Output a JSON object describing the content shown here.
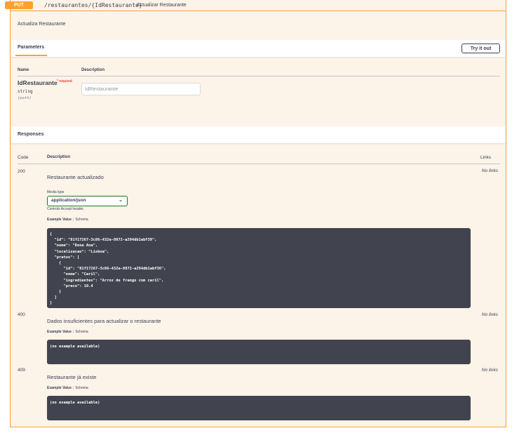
{
  "operation": {
    "method": "PUT",
    "path": "/restaurantes/{IdRestaurante}",
    "summary": "Actualizar Restaurante",
    "description": "Actualiza Restaurante"
  },
  "parameters": {
    "title": "Parameters",
    "try_label": "Try it out",
    "col_name": "Name",
    "col_description": "Description",
    "items": [
      {
        "name": "IdRestaurante",
        "required": "* required",
        "type": "string",
        "in": "(path)",
        "placeholder": "IdRestaurante"
      }
    ]
  },
  "responses": {
    "title": "Responses",
    "col_code": "Code",
    "col_description": "Description",
    "col_links": "Links",
    "media_type_label": "Media type",
    "media_type_value": "application/json",
    "controls_label": "Controls Accept header.",
    "example_tab": "Example Value",
    "schema_tab": "Schema",
    "no_links": "No links",
    "items": [
      {
        "code": "200",
        "description": "Restaurante actualizado",
        "example": "{\n  \"id\": \"81f17267-3c86-432a-8072-a294db1abf39\",\n  \"nome\": \"Dona Ana\",\n  \"localizacao\": \"Lisboa\",\n  \"pratos\": [\n    {\n      \"id\": \"81f17267-3c86-432a-8072-a294db1abf36\",\n      \"nome\": \"Caril\",\n      \"ingredientes\": \"Arroz de frango com caril\",\n      \"preco\": 10.4\n    }\n  ]\n}"
      },
      {
        "code": "400",
        "description": "Dados insuficientes para actualizar o restaurante",
        "example": "(no example available)"
      },
      {
        "code": "409",
        "description": "Restaurante já existe",
        "example": "(no example available)"
      }
    ]
  },
  "colors": {
    "accent": "#fca130",
    "background": "#fcf3e9",
    "code_background": "#41444e"
  }
}
